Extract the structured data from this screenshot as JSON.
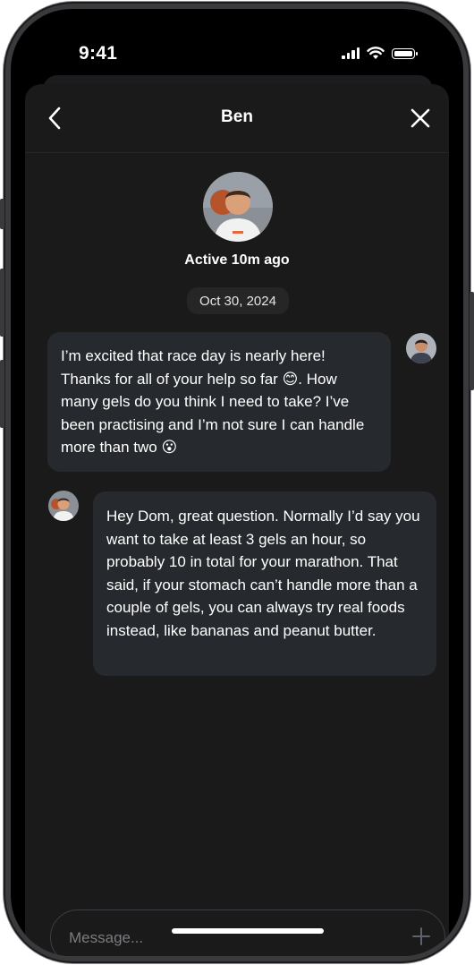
{
  "status_bar": {
    "time": "9:41"
  },
  "header": {
    "title": "Ben"
  },
  "profile": {
    "status": "Active 10m ago"
  },
  "date_divider": "Oct 30, 2024",
  "messages": [
    {
      "from": "me",
      "text": "I’m excited that race day is nearly here! Thanks for all of your help so far 😊. How many gels do you think I need to take? I’ve been practising and I’m not sure I can handle more than two 😮"
    },
    {
      "from": "them",
      "text": "Hey Dom, great question. Normally I’d say you want to take at least 3 gels an hour, so probably 10 in total for your marathon. That said, if your stomach can’t handle more than a couple of gels, you can always try real foods instead, like bananas and peanut butter."
    }
  ],
  "composer": {
    "placeholder": "Message..."
  },
  "colors": {
    "background": "#1a1a1a",
    "bubble": "#262a2e",
    "text": "#ffffff"
  }
}
